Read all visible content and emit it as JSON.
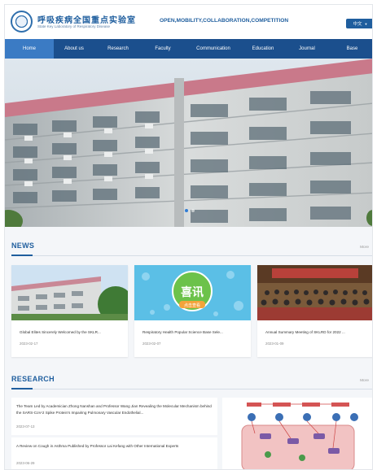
{
  "header": {
    "logo_zh": "呼吸疾病全国重点实验室",
    "logo_en": "State Key Laboratory of Respiratory Disease",
    "slogan": "OPEN,MOBILITY,COLLABORATION,COMPETITION",
    "lang_label": "中文"
  },
  "nav": {
    "items": [
      {
        "label": "Home"
      },
      {
        "label": "About us"
      },
      {
        "label": "Research"
      },
      {
        "label": "Faculty"
      },
      {
        "label": "Communication"
      },
      {
        "label": "Education"
      },
      {
        "label": "Journal"
      },
      {
        "label": "Base"
      }
    ]
  },
  "hero": {
    "active_slide": 1,
    "slides": 2
  },
  "news": {
    "title": "NEWS",
    "more": "More",
    "items": [
      {
        "title": "Global Elites Sincerely Welcomed by the SKLR...",
        "date": "2023-02-17"
      },
      {
        "title": "Respiratory Health Popular Science Base Sele...",
        "date": "2023-02-07"
      },
      {
        "title": "Annual Summary Meeting of SKLRD for 2022 ...",
        "date": "2023-01-09"
      }
    ],
    "badge_main": "喜讯",
    "badge_sub": "点击查看"
  },
  "research": {
    "title": "RESEARCH",
    "more": "More",
    "items": [
      {
        "title": "The Team Led by Academician Zhong Nanshan and Professor Wang Jian Revealing the Molecular Mechanism behind the SARS-CoV-2 Spike Protein's Impairing Pulmonary Vascular Endothelial...",
        "date": "2023-07-13"
      },
      {
        "title": "A Review on Cough in Asthma Published by Professor Lai Kefang with Other International Experts",
        "date": "2023-06-29"
      }
    ]
  }
}
